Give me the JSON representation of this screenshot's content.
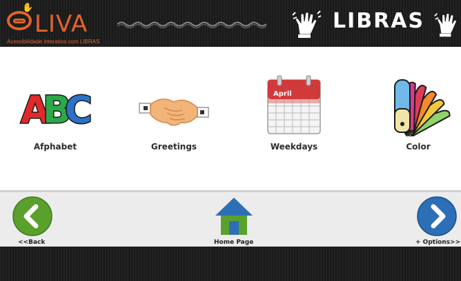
{
  "header": {
    "logo_text": "LIVA",
    "logo_subtitle": "Acessibilidade Interativa com LIBRAS",
    "title": "LIBRAS",
    "hand_icon": "sign-language-hand-icon"
  },
  "categories": [
    {
      "label": "Afphabet",
      "icon": "abc-letters-icon"
    },
    {
      "label": "Greetings",
      "icon": "handshake-icon"
    },
    {
      "label": "Weekdays",
      "icon": "calendar-icon",
      "icon_text": "April"
    },
    {
      "label": "Color",
      "icon": "color-palette-icon"
    }
  ],
  "nav": {
    "back_label": "<<Back",
    "home_label": "Home Page",
    "options_label": "+ Options>>"
  },
  "colors": {
    "header_bg": "#1e1e1e",
    "logo_orange": "#e3632a",
    "back_button_green": "#5aa02c",
    "home_roof_blue": "#2c6fb6",
    "home_body_green": "#5aa02c",
    "options_button_blue": "#2c6fb6",
    "nav_bg": "#ececec"
  }
}
